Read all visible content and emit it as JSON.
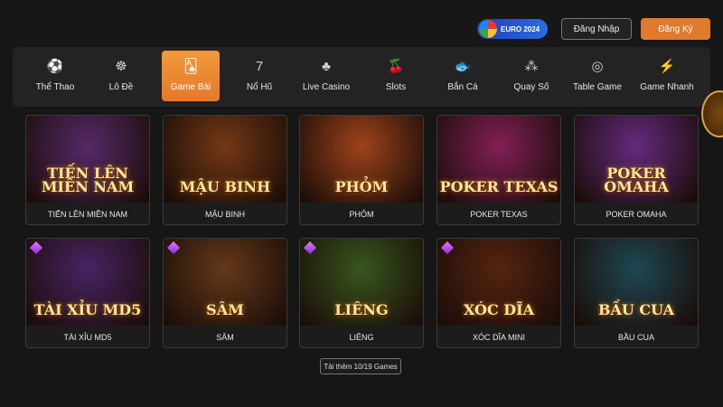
{
  "header": {
    "euro_badge": "EURO 2024",
    "login_label": "Đăng Nhập",
    "register_label": "Đăng Ký"
  },
  "nav": {
    "items": [
      {
        "label": "Thể Thao",
        "icon": "soccer-ball-icon"
      },
      {
        "label": "Lô Đề",
        "icon": "lottery-wheel-icon"
      },
      {
        "label": "Game Bài",
        "icon": "playing-cards-icon"
      },
      {
        "label": "Nổ Hũ",
        "icon": "seven-icon"
      },
      {
        "label": "Live Casino",
        "icon": "club-icon"
      },
      {
        "label": "Slots",
        "icon": "cherries-icon"
      },
      {
        "label": "Bắn Cá",
        "icon": "fish-icon"
      },
      {
        "label": "Quay Số",
        "icon": "balls-icon"
      },
      {
        "label": "Table Game",
        "icon": "chip-icon"
      },
      {
        "label": "Game Nhanh",
        "icon": "lightning-icon"
      }
    ],
    "active_index": 2
  },
  "games": [
    {
      "name": "TIẾN LÊN MIỀN NAM",
      "art": "TIẾN LÊN MIỀN NAM",
      "bg": "#5a2a6e",
      "hot": false
    },
    {
      "name": "MẬU BINH",
      "art": "MẬU BINH",
      "bg": "#7a3a14",
      "hot": false
    },
    {
      "name": "PHỎM",
      "art": "PHỎM",
      "bg": "#a8451a",
      "hot": false
    },
    {
      "name": "POKER TEXAS",
      "art": "POKER TEXAS",
      "bg": "#8a1f5a",
      "hot": false
    },
    {
      "name": "POKER OMAHA",
      "art": "POKER OMAHA",
      "bg": "#6a2a86",
      "hot": false
    },
    {
      "name": "TÀI XỈU MD5",
      "art": "TÀI XỈU MD5",
      "bg": "#4a2468",
      "hot": true
    },
    {
      "name": "SÂM",
      "art": "SÂM",
      "bg": "#6a3a18",
      "hot": true
    },
    {
      "name": "LIÊNG",
      "art": "LIÊNG",
      "bg": "#3a5a1e",
      "hot": true
    },
    {
      "name": "XÓC DĨA MINI",
      "art": "XÓC DĨA",
      "bg": "#5a2410",
      "hot": true
    },
    {
      "name": "BẦU CUA",
      "art": "BẦU CUA",
      "bg": "#1e4a58",
      "hot": false
    }
  ],
  "load_more_label": "Tải thêm 10/19 Games",
  "colors": {
    "accent": "#e07b2e",
    "bg": "#161616"
  }
}
